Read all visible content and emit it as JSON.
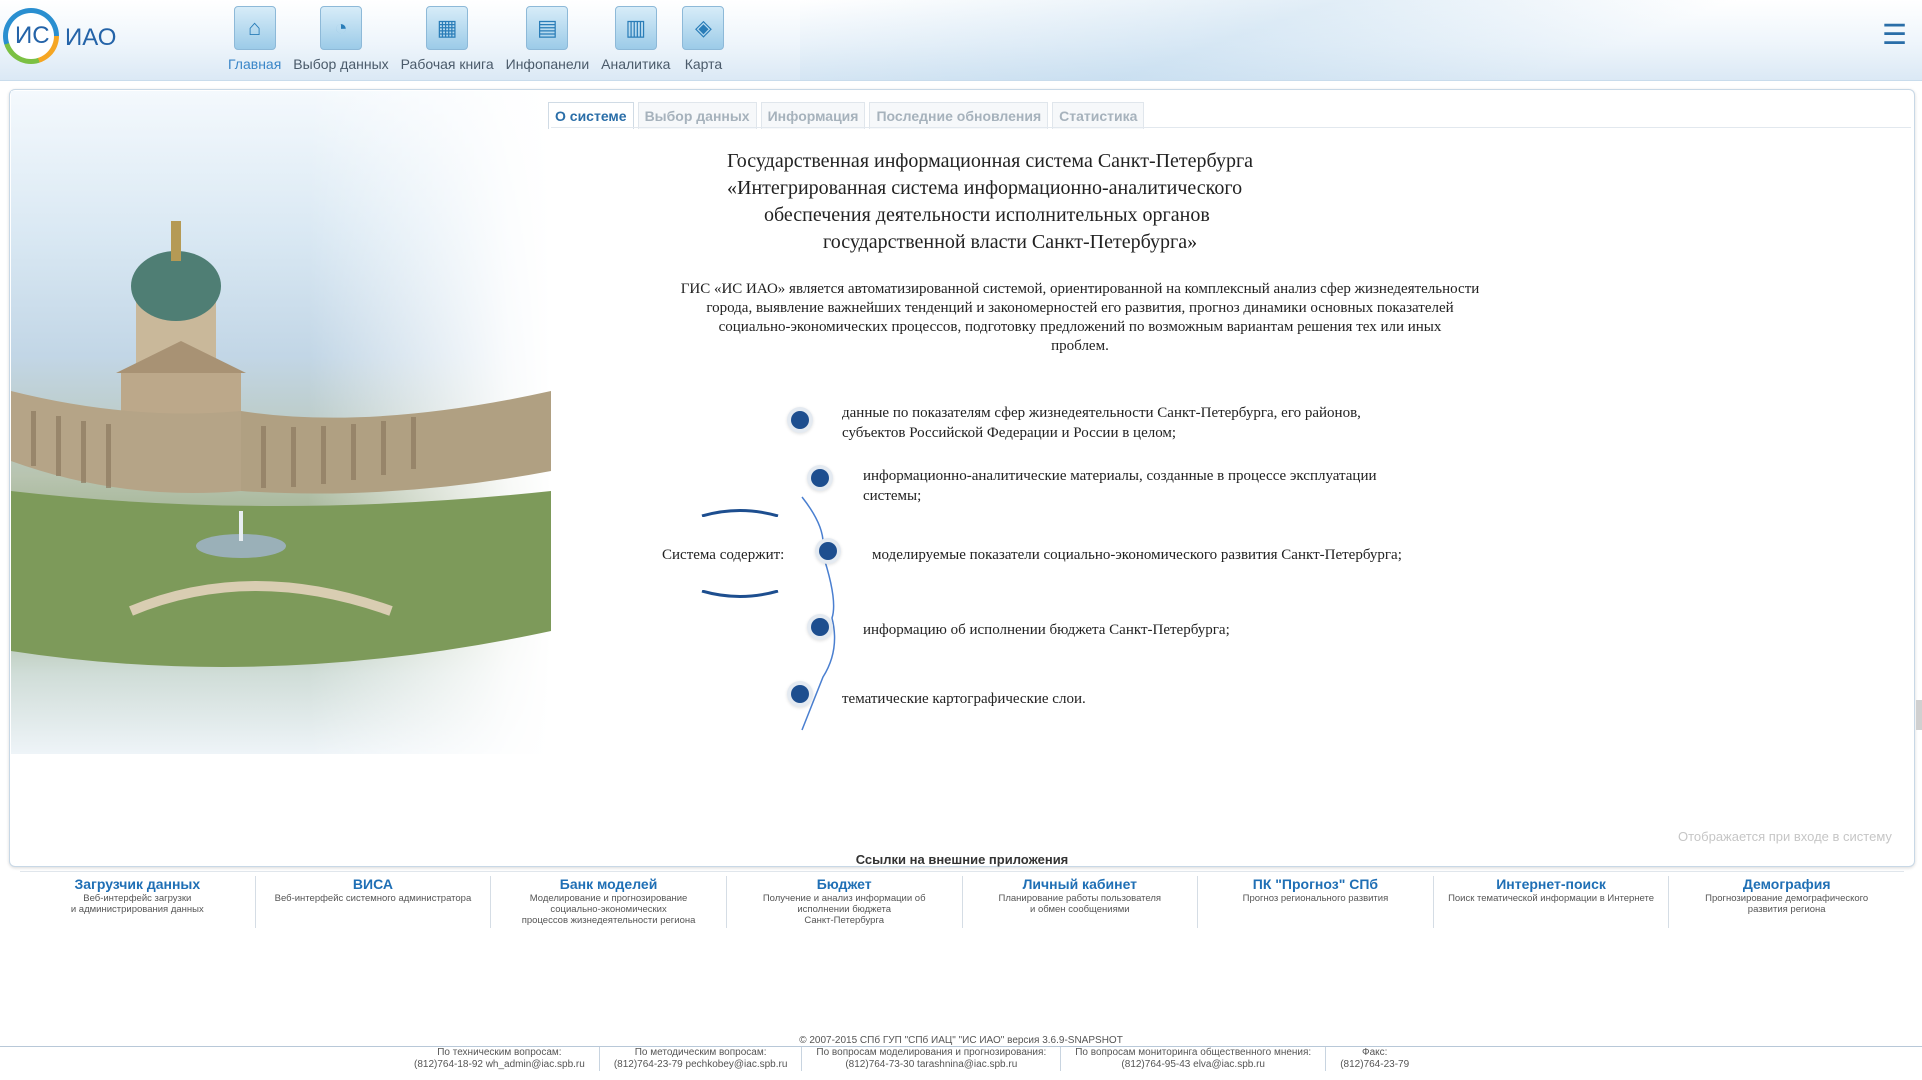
{
  "app": {
    "logo_text_1": "ИС",
    "logo_text_2": "ИАО"
  },
  "nav": [
    {
      "label": "Главная",
      "icon": "home-icon",
      "active": true
    },
    {
      "label": "Выбор данных",
      "icon": "data-select-icon"
    },
    {
      "label": "Рабочая книга",
      "icon": "workbook-icon"
    },
    {
      "label": "Инфопанели",
      "icon": "dashboard-icon"
    },
    {
      "label": "Аналитика",
      "icon": "analytics-icon"
    },
    {
      "label": "Карта",
      "icon": "map-icon"
    }
  ],
  "tabs": [
    {
      "label": "О системе",
      "active": true
    },
    {
      "label": "Выбор данных"
    },
    {
      "label": "Информация"
    },
    {
      "label": "Последние обновления"
    },
    {
      "label": "Статистика"
    }
  ],
  "about": {
    "title": [
      "Государственная информационная система Санкт-Петербурга",
      "«Интегрированная система информационно-аналитического",
      "обеспечения деятельности исполнительных органов",
      "государственной власти Санкт-Петербурга»"
    ],
    "intro": [
      "ГИС «ИС ИАО» является автоматизированной системой, ориентированной на комплексный анализ сфер жизнедеятельности",
      "города, выявление важнейших тенденций и закономерностей его развития, прогноз динамики основных показателей",
      "социально-экономических процессов, подготовку предложений по возможным вариантам решения тех или иных",
      "проблем."
    ],
    "system_label": "Система содержит:",
    "items": [
      [
        "данные по показателям сфер жизнедеятельности Санкт-Петербурга, его районов,",
        "субъектов Российской Федерации и России в целом;"
      ],
      [
        "информационно-аналитические материалы, созданные в процессе эксплуатации",
        "системы;"
      ],
      [
        "моделируемые показатели социально-экономического развития Санкт-Петербурга;"
      ],
      [
        "информацию об исполнении бюджета Санкт-Петербурга;"
      ],
      [
        "тематические картографические слои."
      ]
    ],
    "login_note": "Отображается при входе в систему"
  },
  "external": {
    "title": "Ссылки на внешние приложения",
    "apps": [
      {
        "name": "Загрузчик данных",
        "desc": "Веб-интерфейс загрузки\nи администрирования данных"
      },
      {
        "name": "ВИСА",
        "desc": "Веб-интерфейс системного администратора"
      },
      {
        "name": "Банк моделей",
        "desc": "Моделирование и прогнозирование\nсоциально-экономических\nпроцессов жизнедеятельности региона"
      },
      {
        "name": "Бюджет",
        "desc": "Получение и анализ информации об\nисполнении бюджета\nСанкт-Петербурга"
      },
      {
        "name": "Личный кабинет",
        "desc": "Планирование работы пользователя\nи обмен сообщениями"
      },
      {
        "name": "ПК \"Прогноз\" СПб",
        "desc": "Прогноз регионального развития"
      },
      {
        "name": "Интернет-поиск",
        "desc": "Поиск тематической информации в Интернете"
      },
      {
        "name": "Демография",
        "desc": "Прогнозирование демографического\nразвития региона"
      }
    ]
  },
  "footer": {
    "copyright": "© 2007-2015 СПб ГУП \"СПб ИАЦ\" \"ИС ИАО\" версия 3.6.9-SNAPSHOT",
    "contacts": [
      {
        "label": "По техническим вопросам:",
        "value": "(812)764-18-92   wh_admin@iac.spb.ru"
      },
      {
        "label": "По методическим вопросам:",
        "value": "(812)764-23-79   pechkobey@iac.spb.ru"
      },
      {
        "label": "По вопросам моделирования и прогнозирования:",
        "value": "(812)764-73-30   tarashnina@iac.spb.ru"
      },
      {
        "label": "По вопросам мониторинга общественного мнения:",
        "value": "(812)764-95-43   elva@iac.spb.ru"
      },
      {
        "label": "Факс:",
        "value": "(812)764-23-79"
      }
    ]
  },
  "colors": {
    "accent": "#2a6ea8",
    "link": "#1f6fb5",
    "dot": "#1d4e8f"
  }
}
